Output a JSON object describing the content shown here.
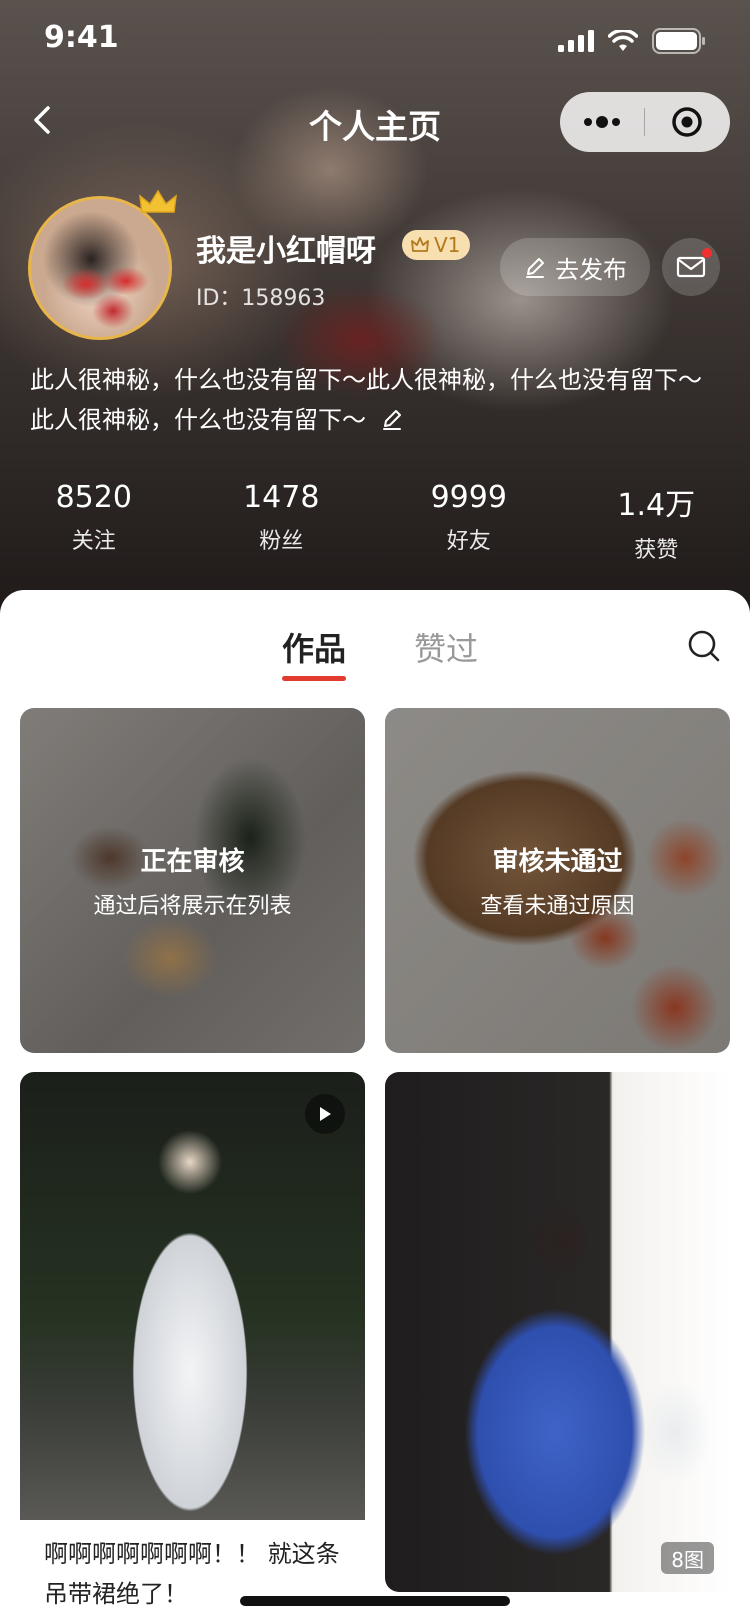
{
  "status_bar": {
    "time": "9:41"
  },
  "nav": {
    "title": "个人主页"
  },
  "profile": {
    "name": "我是小红帽呀",
    "level": "V1",
    "id_text": "ID：158963",
    "bio": "此人很神秘，什么也没有留下～此人很神秘，什么也没有留下～此人很神秘，什么也没有留下～",
    "publish_label": "去发布"
  },
  "stats": [
    {
      "value": "8520",
      "label": "关注"
    },
    {
      "value": "1478",
      "label": "粉丝"
    },
    {
      "value": "9999",
      "label": "好友"
    },
    {
      "value": "1.4万",
      "label": "获赞"
    }
  ],
  "tabs": {
    "works": "作品",
    "liked": "赞过"
  },
  "cards": [
    {
      "title": "正在审核",
      "subtitle": "通过后将展示在列表"
    },
    {
      "title": "审核未通过",
      "subtitle": "查看未通过原因"
    },
    {
      "caption": "啊啊啊啊啊啊啊！！ 就这条吊带裙绝了！"
    },
    {
      "image_count": "8图"
    }
  ],
  "colors": {
    "accent": "#e23a2f",
    "badge_bg": "#f7dfb0",
    "avatar_border": "#e8b54a"
  }
}
